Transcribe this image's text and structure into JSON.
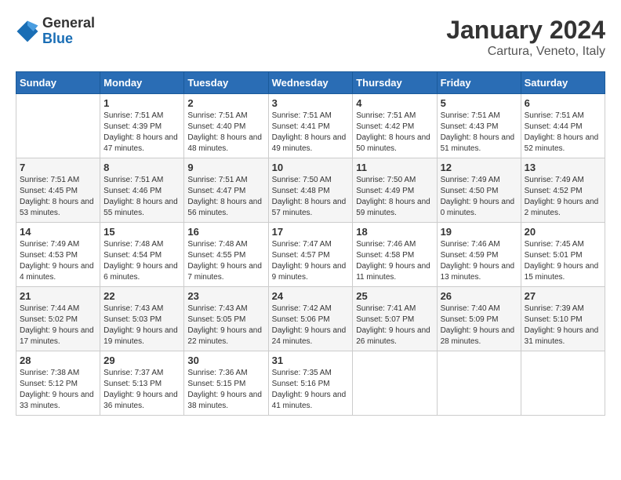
{
  "logo": {
    "general": "General",
    "blue": "Blue"
  },
  "title": "January 2024",
  "subtitle": "Cartura, Veneto, Italy",
  "days_header": [
    "Sunday",
    "Monday",
    "Tuesday",
    "Wednesday",
    "Thursday",
    "Friday",
    "Saturday"
  ],
  "weeks": [
    [
      {
        "day": "",
        "sunrise": "",
        "sunset": "",
        "daylight": ""
      },
      {
        "day": "1",
        "sunrise": "Sunrise: 7:51 AM",
        "sunset": "Sunset: 4:39 PM",
        "daylight": "Daylight: 8 hours and 47 minutes."
      },
      {
        "day": "2",
        "sunrise": "Sunrise: 7:51 AM",
        "sunset": "Sunset: 4:40 PM",
        "daylight": "Daylight: 8 hours and 48 minutes."
      },
      {
        "day": "3",
        "sunrise": "Sunrise: 7:51 AM",
        "sunset": "Sunset: 4:41 PM",
        "daylight": "Daylight: 8 hours and 49 minutes."
      },
      {
        "day": "4",
        "sunrise": "Sunrise: 7:51 AM",
        "sunset": "Sunset: 4:42 PM",
        "daylight": "Daylight: 8 hours and 50 minutes."
      },
      {
        "day": "5",
        "sunrise": "Sunrise: 7:51 AM",
        "sunset": "Sunset: 4:43 PM",
        "daylight": "Daylight: 8 hours and 51 minutes."
      },
      {
        "day": "6",
        "sunrise": "Sunrise: 7:51 AM",
        "sunset": "Sunset: 4:44 PM",
        "daylight": "Daylight: 8 hours and 52 minutes."
      }
    ],
    [
      {
        "day": "7",
        "sunrise": "Sunrise: 7:51 AM",
        "sunset": "Sunset: 4:45 PM",
        "daylight": "Daylight: 8 hours and 53 minutes."
      },
      {
        "day": "8",
        "sunrise": "Sunrise: 7:51 AM",
        "sunset": "Sunset: 4:46 PM",
        "daylight": "Daylight: 8 hours and 55 minutes."
      },
      {
        "day": "9",
        "sunrise": "Sunrise: 7:51 AM",
        "sunset": "Sunset: 4:47 PM",
        "daylight": "Daylight: 8 hours and 56 minutes."
      },
      {
        "day": "10",
        "sunrise": "Sunrise: 7:50 AM",
        "sunset": "Sunset: 4:48 PM",
        "daylight": "Daylight: 8 hours and 57 minutes."
      },
      {
        "day": "11",
        "sunrise": "Sunrise: 7:50 AM",
        "sunset": "Sunset: 4:49 PM",
        "daylight": "Daylight: 8 hours and 59 minutes."
      },
      {
        "day": "12",
        "sunrise": "Sunrise: 7:49 AM",
        "sunset": "Sunset: 4:50 PM",
        "daylight": "Daylight: 9 hours and 0 minutes."
      },
      {
        "day": "13",
        "sunrise": "Sunrise: 7:49 AM",
        "sunset": "Sunset: 4:52 PM",
        "daylight": "Daylight: 9 hours and 2 minutes."
      }
    ],
    [
      {
        "day": "14",
        "sunrise": "Sunrise: 7:49 AM",
        "sunset": "Sunset: 4:53 PM",
        "daylight": "Daylight: 9 hours and 4 minutes."
      },
      {
        "day": "15",
        "sunrise": "Sunrise: 7:48 AM",
        "sunset": "Sunset: 4:54 PM",
        "daylight": "Daylight: 9 hours and 6 minutes."
      },
      {
        "day": "16",
        "sunrise": "Sunrise: 7:48 AM",
        "sunset": "Sunset: 4:55 PM",
        "daylight": "Daylight: 9 hours and 7 minutes."
      },
      {
        "day": "17",
        "sunrise": "Sunrise: 7:47 AM",
        "sunset": "Sunset: 4:57 PM",
        "daylight": "Daylight: 9 hours and 9 minutes."
      },
      {
        "day": "18",
        "sunrise": "Sunrise: 7:46 AM",
        "sunset": "Sunset: 4:58 PM",
        "daylight": "Daylight: 9 hours and 11 minutes."
      },
      {
        "day": "19",
        "sunrise": "Sunrise: 7:46 AM",
        "sunset": "Sunset: 4:59 PM",
        "daylight": "Daylight: 9 hours and 13 minutes."
      },
      {
        "day": "20",
        "sunrise": "Sunrise: 7:45 AM",
        "sunset": "Sunset: 5:01 PM",
        "daylight": "Daylight: 9 hours and 15 minutes."
      }
    ],
    [
      {
        "day": "21",
        "sunrise": "Sunrise: 7:44 AM",
        "sunset": "Sunset: 5:02 PM",
        "daylight": "Daylight: 9 hours and 17 minutes."
      },
      {
        "day": "22",
        "sunrise": "Sunrise: 7:43 AM",
        "sunset": "Sunset: 5:03 PM",
        "daylight": "Daylight: 9 hours and 19 minutes."
      },
      {
        "day": "23",
        "sunrise": "Sunrise: 7:43 AM",
        "sunset": "Sunset: 5:05 PM",
        "daylight": "Daylight: 9 hours and 22 minutes."
      },
      {
        "day": "24",
        "sunrise": "Sunrise: 7:42 AM",
        "sunset": "Sunset: 5:06 PM",
        "daylight": "Daylight: 9 hours and 24 minutes."
      },
      {
        "day": "25",
        "sunrise": "Sunrise: 7:41 AM",
        "sunset": "Sunset: 5:07 PM",
        "daylight": "Daylight: 9 hours and 26 minutes."
      },
      {
        "day": "26",
        "sunrise": "Sunrise: 7:40 AM",
        "sunset": "Sunset: 5:09 PM",
        "daylight": "Daylight: 9 hours and 28 minutes."
      },
      {
        "day": "27",
        "sunrise": "Sunrise: 7:39 AM",
        "sunset": "Sunset: 5:10 PM",
        "daylight": "Daylight: 9 hours and 31 minutes."
      }
    ],
    [
      {
        "day": "28",
        "sunrise": "Sunrise: 7:38 AM",
        "sunset": "Sunset: 5:12 PM",
        "daylight": "Daylight: 9 hours and 33 minutes."
      },
      {
        "day": "29",
        "sunrise": "Sunrise: 7:37 AM",
        "sunset": "Sunset: 5:13 PM",
        "daylight": "Daylight: 9 hours and 36 minutes."
      },
      {
        "day": "30",
        "sunrise": "Sunrise: 7:36 AM",
        "sunset": "Sunset: 5:15 PM",
        "daylight": "Daylight: 9 hours and 38 minutes."
      },
      {
        "day": "31",
        "sunrise": "Sunrise: 7:35 AM",
        "sunset": "Sunset: 5:16 PM",
        "daylight": "Daylight: 9 hours and 41 minutes."
      },
      {
        "day": "",
        "sunrise": "",
        "sunset": "",
        "daylight": ""
      },
      {
        "day": "",
        "sunrise": "",
        "sunset": "",
        "daylight": ""
      },
      {
        "day": "",
        "sunrise": "",
        "sunset": "",
        "daylight": ""
      }
    ]
  ]
}
